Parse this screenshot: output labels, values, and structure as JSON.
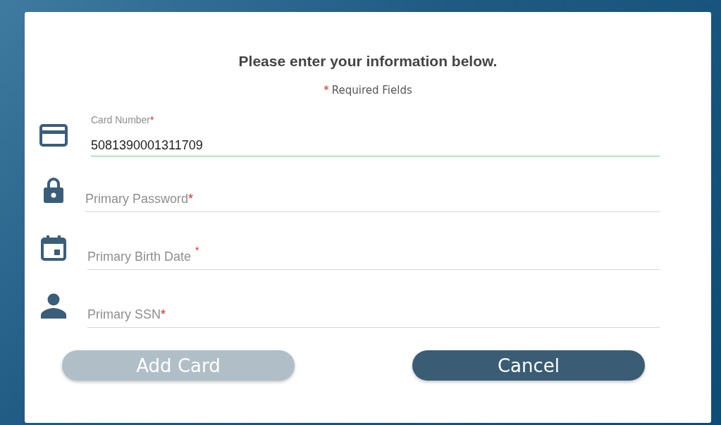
{
  "heading": "Please enter your information below.",
  "required_note": {
    "mark": "*",
    "text": "Required Fields"
  },
  "fields": [
    {
      "kind": "card",
      "label": "Card Number",
      "mark": "*",
      "value": "5081390001311709",
      "focused": true
    },
    {
      "kind": "lock",
      "placeholder": "Primary Password",
      "mark": "*",
      "focused": false
    },
    {
      "kind": "calendar",
      "placeholder": "Primary Birth Date",
      "mark": "*",
      "raised_mark": true,
      "focused": false
    },
    {
      "kind": "person",
      "placeholder": "Primary SSN",
      "mark": "*",
      "focused": false
    }
  ],
  "buttons": [
    {
      "label": "Add Card",
      "disabled": true
    },
    {
      "label": "Cancel",
      "disabled": false
    }
  ]
}
